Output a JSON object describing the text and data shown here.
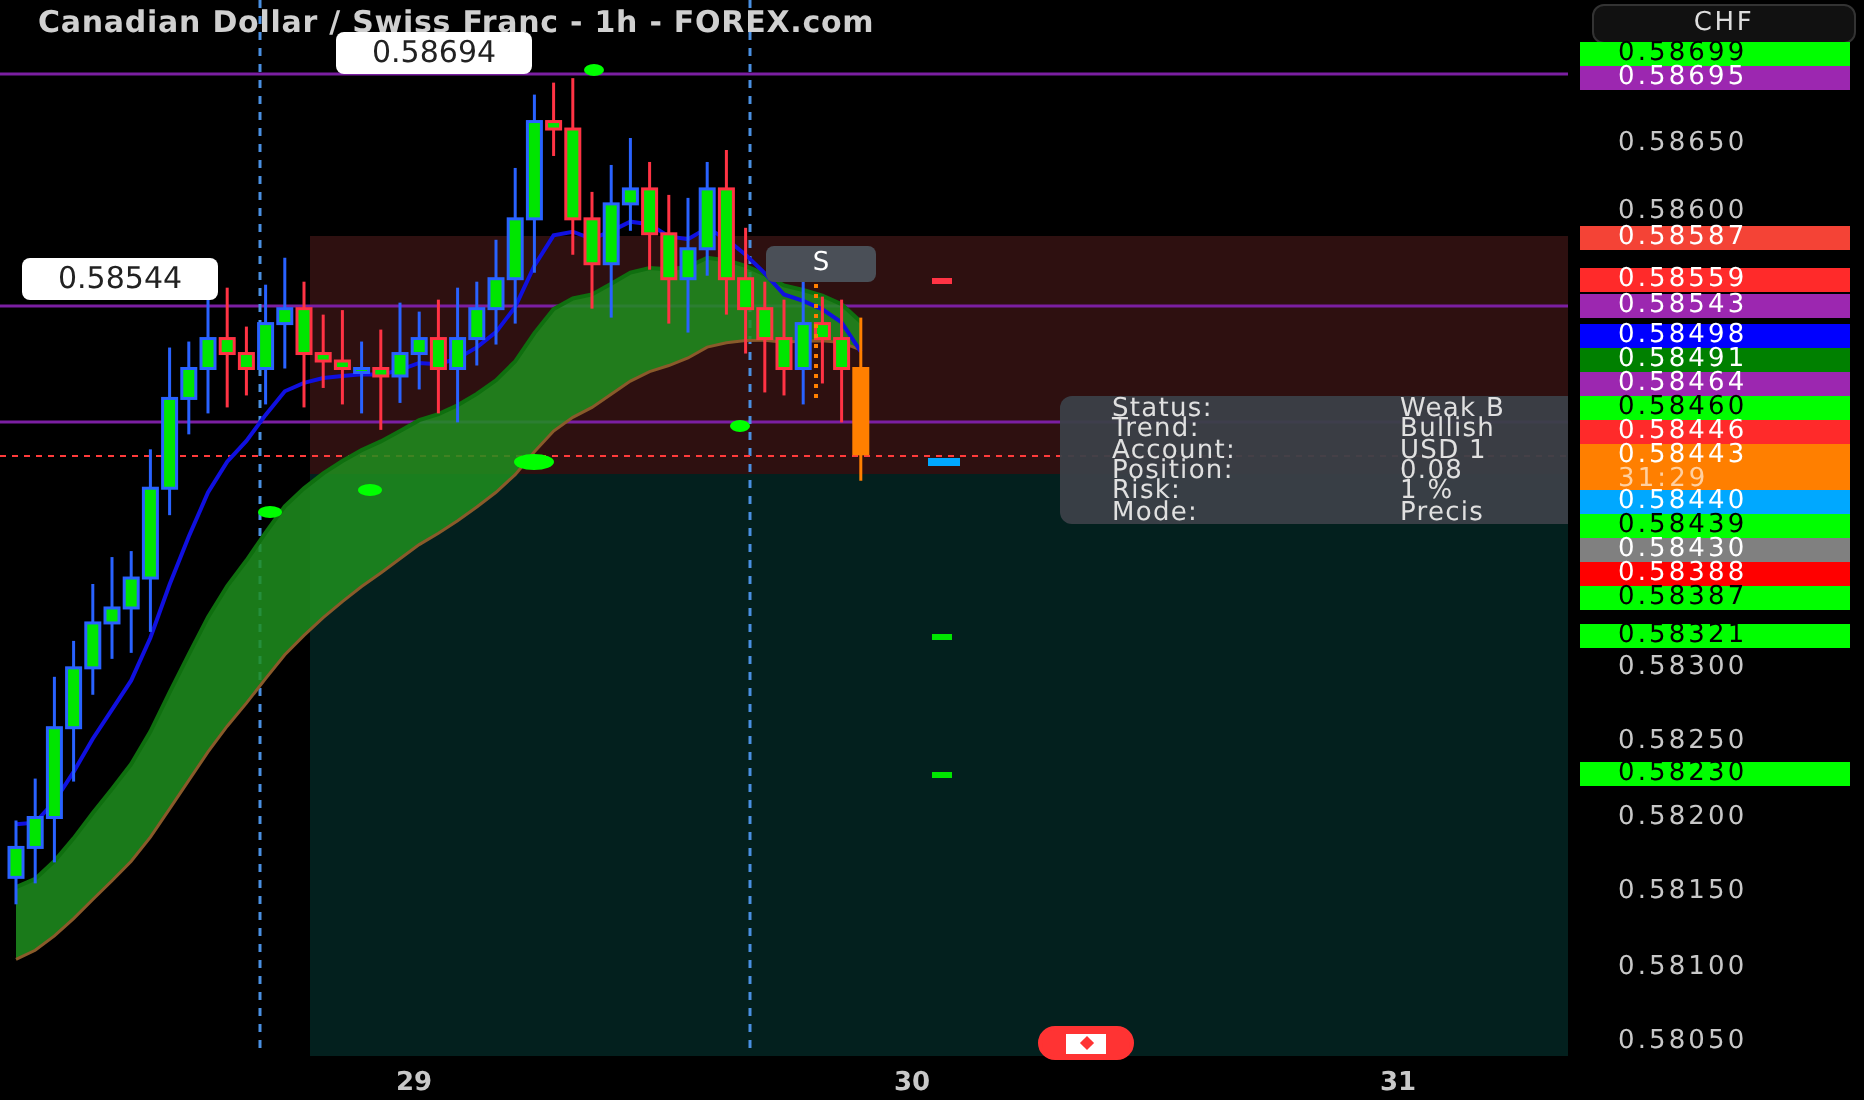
{
  "title": "Canadian Dollar / Swiss Franc - 1h - FOREX.com",
  "currency": "CHF",
  "price_labels": [
    {
      "price": "0.58699",
      "kind": "badge",
      "color": "#00ff00"
    },
    {
      "price": "0.58695",
      "kind": "badge",
      "color": "#9c27b0"
    },
    {
      "price": "0.58650",
      "kind": "tick"
    },
    {
      "price": "0.58600",
      "kind": "tick"
    },
    {
      "price": "0.58587",
      "kind": "badge",
      "color": "#f44336"
    },
    {
      "price": "0.58559",
      "kind": "badge",
      "color": "#ff2a2a"
    },
    {
      "price": "0.58543",
      "kind": "badge",
      "color": "#9c27b0"
    },
    {
      "price": "0.58498",
      "kind": "badge",
      "color": "#0000ff"
    },
    {
      "price": "0.58491",
      "kind": "badge",
      "color": "#008000"
    },
    {
      "price": "0.58464",
      "kind": "badge",
      "color": "#9c27b0"
    },
    {
      "price": "0.58460",
      "kind": "badge",
      "color": "#00ff00"
    },
    {
      "price": "0.58446",
      "kind": "badge",
      "color": "#ff2a2a"
    },
    {
      "price": "0.58443",
      "kind": "badge",
      "color": "#ff7f00",
      "countdown": "31:29"
    },
    {
      "price": "0.58440",
      "kind": "badge",
      "color": "#00a8ff"
    },
    {
      "price": "0.58439",
      "kind": "badge",
      "color": "#00ff00"
    },
    {
      "price": "0.58430",
      "kind": "badge",
      "color": "#808080"
    },
    {
      "price": "0.58388",
      "kind": "badge",
      "color": "#ff0000"
    },
    {
      "price": "0.58387",
      "kind": "badge",
      "color": "#00ff00"
    },
    {
      "price": "0.58321",
      "kind": "badge",
      "color": "#00ff00"
    },
    {
      "price": "0.58300",
      "kind": "tick"
    },
    {
      "price": "0.58250",
      "kind": "tick"
    },
    {
      "price": "0.58230",
      "kind": "badge",
      "color": "#00ff00"
    },
    {
      "price": "0.58200",
      "kind": "tick"
    },
    {
      "price": "0.58150",
      "kind": "tick"
    },
    {
      "price": "0.58100",
      "kind": "tick"
    },
    {
      "price": "0.58050",
      "kind": "tick"
    }
  ],
  "callouts": [
    {
      "price": "0.58694"
    },
    {
      "price": "0.58544"
    }
  ],
  "signal_marker": {
    "label": "S"
  },
  "info_panel": {
    "rows": [
      {
        "label": "Status:",
        "value": "Weak B"
      },
      {
        "label": "Trend:",
        "value": "Bullish"
      },
      {
        "label": "Account:",
        "value": "USD 1"
      },
      {
        "label": "Position:",
        "value": "0.08"
      },
      {
        "label": "Risk:",
        "value": "1 %"
      },
      {
        "label": "Mode:",
        "value": "Precis"
      }
    ]
  },
  "time_axis": {
    "labels": [
      "29",
      "30",
      "31"
    ]
  }
}
